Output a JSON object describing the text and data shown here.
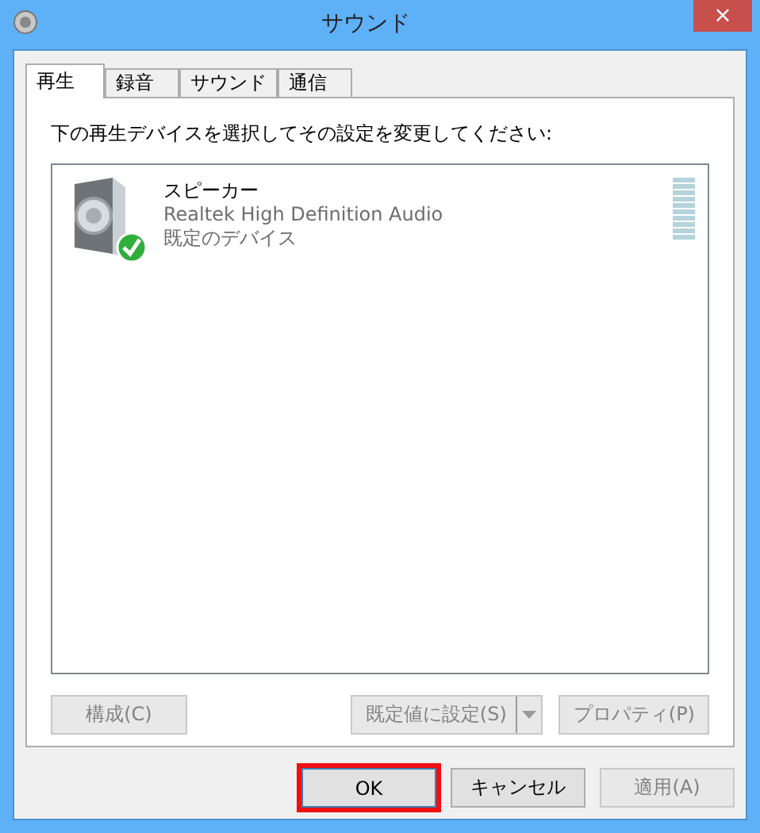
{
  "window": {
    "title": "サウンド",
    "close": "×"
  },
  "tabs": [
    {
      "label": "再生",
      "selected": true
    },
    {
      "label": "録音",
      "selected": false
    },
    {
      "label": "サウンド",
      "selected": false
    },
    {
      "label": "通信",
      "selected": false
    }
  ],
  "instruction": "下の再生デバイスを選択してその設定を変更してください:",
  "devices": [
    {
      "name": "スピーカー",
      "driver": "Realtek High Definition Audio",
      "status": "既定のデバイス",
      "is_default": true
    }
  ],
  "panel_buttons": [
    {
      "kind": "plain",
      "label": "構成(C)",
      "disabled": true
    },
    {
      "kind": "split",
      "label": "既定値に設定(S)",
      "disabled": true
    },
    {
      "kind": "plain",
      "label": "プロパティ(P)",
      "disabled": true
    }
  ],
  "dialog_buttons": [
    {
      "label": "OK",
      "disabled": false,
      "highlighted": true
    },
    {
      "label": "キャンセル",
      "disabled": false,
      "highlighted": false
    },
    {
      "label": "適用(A)",
      "disabled": true,
      "highlighted": false
    }
  ]
}
